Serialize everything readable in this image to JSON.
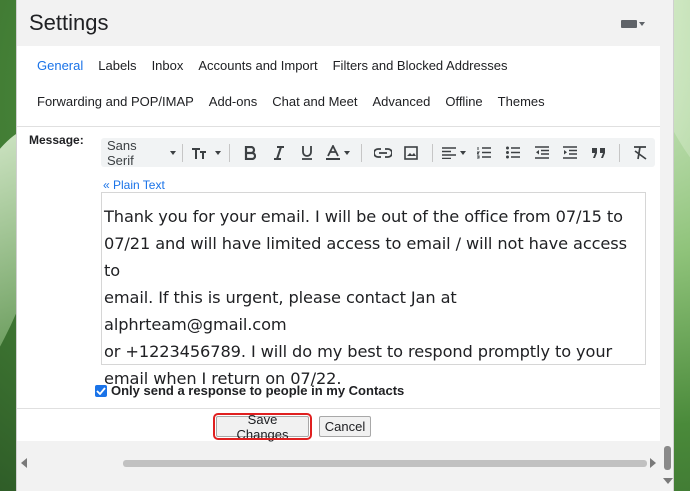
{
  "window": {
    "title": "Settings"
  },
  "tabs_row1": [
    "General",
    "Labels",
    "Inbox",
    "Accounts and Import",
    "Filters and Blocked Addresses"
  ],
  "tabs_row2": [
    "Forwarding and POP/IMAP",
    "Add-ons",
    "Chat and Meet",
    "Advanced",
    "Offline",
    "Themes"
  ],
  "active_tab": "General",
  "message": {
    "label": "Message:",
    "font": "Sans Serif",
    "plain_text_link": "« Plain Text",
    "lines": [
      "Thank you for your email. I will be out of the office from 07/15 to",
      "07/21 and will have limited access to email / will not have access to",
      "email. If this is urgent, please contact Jan at alphrteam@gmail.com",
      "or +1223456789. I will do my best to respond promptly to your",
      "email when I return on 07/22."
    ]
  },
  "contacts_only": {
    "label": "Only send a response to people in my Contacts",
    "checked": true
  },
  "buttons": {
    "save": "Save Changes",
    "cancel": "Cancel"
  },
  "colors": {
    "accent": "#1a73e8",
    "highlight": "#e02020"
  }
}
